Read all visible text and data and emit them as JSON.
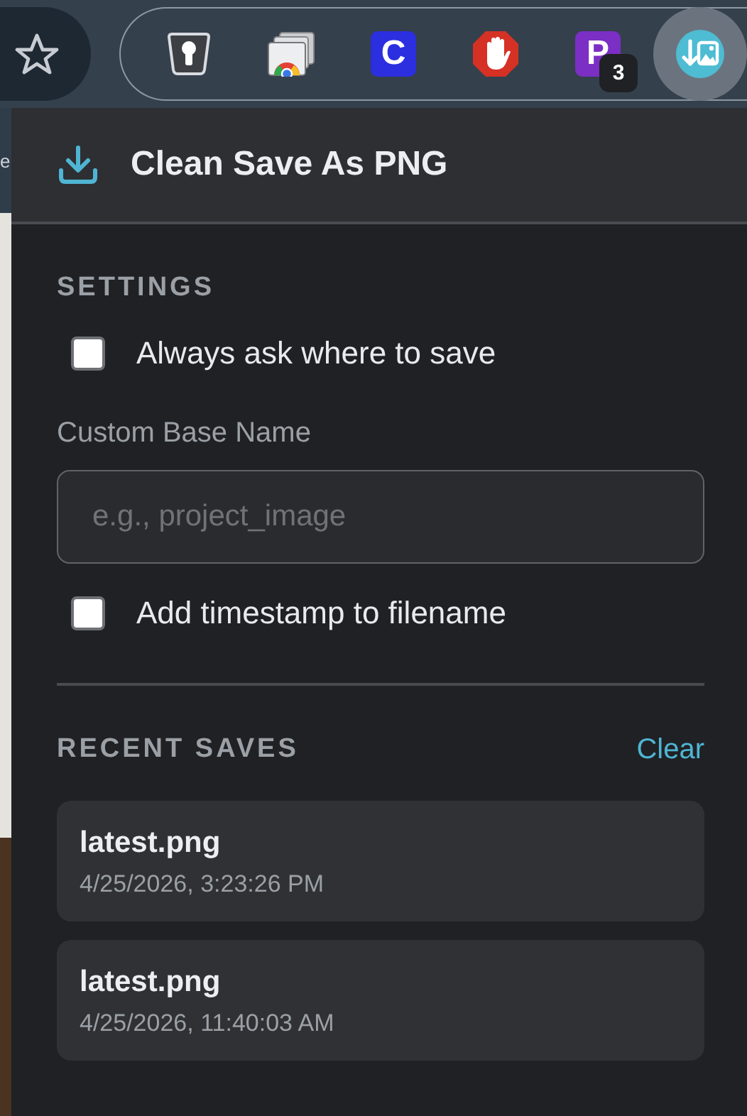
{
  "toolbar": {
    "extensions": [
      {
        "kind": "keyhole"
      },
      {
        "kind": "windows"
      },
      {
        "kind": "letter",
        "label": "C",
        "color": "#2b2fe0"
      },
      {
        "kind": "stop"
      },
      {
        "kind": "letter",
        "label": "P",
        "color": "#7b2fc4",
        "badge": "3"
      },
      {
        "kind": "saver",
        "active": true
      }
    ]
  },
  "page_fragment": "e",
  "popup": {
    "title": "Clean Save As PNG",
    "settings_heading": "SETTINGS",
    "options": [
      {
        "label": "Always ask where to save",
        "checked": false
      }
    ],
    "field": {
      "label": "Custom Base Name",
      "placeholder": "e.g., project_image"
    },
    "options_after": [
      {
        "label": "Add timestamp to filename",
        "checked": false
      }
    ],
    "recent_heading": "RECENT SAVES",
    "clear": "Clear",
    "saves": [
      {
        "name": "latest.png",
        "time": "4/25/2026, 3:23:26 PM"
      },
      {
        "name": "latest.png",
        "time": "4/25/2026, 11:40:03 AM"
      }
    ]
  }
}
